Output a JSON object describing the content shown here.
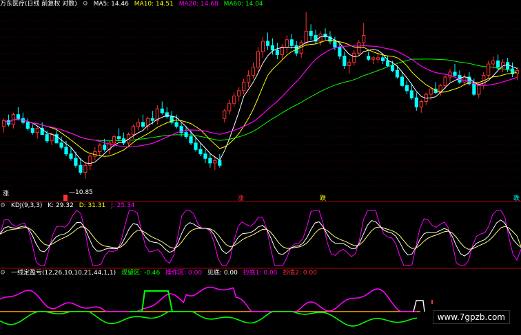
{
  "header": {
    "stock_title": "万东医疗(日线 前复权 对数)",
    "gear_icon": "gear-icon",
    "ma": [
      {
        "label": "MA5: 14.46",
        "color": "#ffffff"
      },
      {
        "label": "MA10: 14.51",
        "color": "#ffff00"
      },
      {
        "label": "MA20: 14.68",
        "color": "#ff00ff"
      },
      {
        "label": "MA60: 14.04",
        "color": "#00ff00"
      }
    ]
  },
  "signals": {
    "left": "涨",
    "middle_zhang": "涨",
    "middle_die": "跌",
    "right": "跌",
    "low_label": "10.85"
  },
  "kdj": {
    "title": "KDJ(9,3,3)",
    "k": "K: 29.32",
    "d": "D: 31.31",
    "j": "J: 25.34"
  },
  "indicator": {
    "title": "一线定盈亏(12,26,10,10,21,44,1,1)",
    "guanwang": "观望区: -0.46",
    "caozuo": "操作区: 0.00",
    "jiandi": "见底: 0.00",
    "chaodi1": "抄底1: 0.00",
    "chaodi2": "抄底2: 0.00"
  },
  "watermark": "www.7gpzb.com",
  "colors": {
    "up": "#ff3232",
    "down": "#00ffff",
    "ma5": "#ffffff",
    "ma10": "#ffff00",
    "ma20": "#ff00ff",
    "ma60": "#00ff00",
    "divider": "#b00000",
    "magenta": "#ff00ff",
    "green": "#00ff00",
    "yellow_kd": "#ffff80",
    "orange": "#ffa500"
  },
  "chart_data": {
    "type": "candlestick",
    "panels": [
      "price",
      "kdj",
      "indicator"
    ],
    "price_low_marker": 10.85,
    "kdj_last": {
      "K": 29.32,
      "D": 31.31,
      "J": 25.34
    },
    "ma_last": {
      "MA5": 14.46,
      "MA10": 14.51,
      "MA20": 14.68,
      "MA60": 14.04
    },
    "indicator_last": {
      "观望区": -0.46,
      "操作区": 0.0,
      "见底": 0.0,
      "抄底1": 0.0,
      "抄底2": 0.0
    },
    "y_range_price": [
      10.5,
      20.5
    ],
    "candles": [
      [
        13.2,
        13.6,
        12.9,
        13.5
      ],
      [
        13.5,
        13.8,
        13.2,
        13.3
      ],
      [
        13.3,
        13.9,
        13.1,
        13.8
      ],
      [
        13.8,
        14.2,
        13.5,
        13.6
      ],
      [
        13.6,
        13.9,
        13.3,
        13.4
      ],
      [
        13.4,
        13.6,
        13.0,
        13.1
      ],
      [
        13.1,
        13.3,
        12.8,
        12.9
      ],
      [
        12.9,
        13.2,
        12.6,
        13.1
      ],
      [
        13.1,
        13.4,
        12.8,
        12.8
      ],
      [
        12.8,
        13.0,
        12.4,
        12.5
      ],
      [
        12.5,
        12.9,
        12.3,
        12.8
      ],
      [
        12.8,
        13.0,
        12.4,
        12.4
      ],
      [
        12.4,
        12.7,
        12.1,
        12.2
      ],
      [
        12.2,
        12.5,
        11.8,
        11.9
      ],
      [
        11.9,
        12.2,
        11.6,
        11.7
      ],
      [
        11.7,
        12.0,
        11.3,
        11.4
      ],
      [
        11.4,
        11.7,
        11.0,
        11.1
      ],
      [
        11.1,
        11.5,
        10.85,
        11.4
      ],
      [
        11.4,
        11.9,
        11.2,
        11.8
      ],
      [
        11.8,
        12.2,
        11.6,
        12.0
      ],
      [
        12.0,
        12.4,
        11.8,
        12.3
      ],
      [
        12.3,
        12.6,
        12.0,
        12.1
      ],
      [
        12.1,
        12.5,
        11.9,
        12.4
      ],
      [
        12.4,
        12.8,
        12.2,
        12.7
      ],
      [
        12.7,
        13.1,
        12.5,
        12.6
      ],
      [
        12.6,
        12.9,
        12.3,
        12.4
      ],
      [
        12.4,
        12.9,
        12.2,
        12.8
      ],
      [
        12.8,
        13.3,
        12.6,
        13.2
      ],
      [
        13.2,
        13.6,
        13.0,
        13.4
      ],
      [
        13.4,
        13.8,
        13.1,
        13.2
      ],
      [
        13.2,
        13.7,
        13.0,
        13.6
      ],
      [
        13.6,
        14.0,
        13.3,
        13.5
      ],
      [
        13.5,
        14.3,
        13.3,
        14.1
      ],
      [
        14.1,
        14.5,
        13.8,
        13.9
      ],
      [
        13.9,
        14.2,
        13.6,
        13.7
      ],
      [
        13.7,
        14.0,
        13.3,
        13.4
      ],
      [
        13.4,
        13.8,
        13.1,
        13.2
      ],
      [
        13.2,
        13.4,
        12.7,
        12.9
      ],
      [
        12.9,
        13.2,
        12.6,
        12.7
      ],
      [
        12.7,
        13.0,
        12.3,
        12.4
      ],
      [
        12.4,
        12.7,
        12.0,
        12.1
      ],
      [
        12.1,
        12.4,
        11.8,
        11.9
      ],
      [
        11.9,
        12.1,
        11.5,
        11.7
      ],
      [
        11.7,
        11.9,
        11.3,
        11.5
      ],
      [
        11.5,
        11.8,
        11.2,
        11.6
      ],
      [
        11.6,
        11.9,
        11.3,
        11.4
      ],
      [
        13.6,
        14.1,
        13.4,
        14.0
      ],
      [
        14.0,
        14.6,
        13.8,
        14.4
      ],
      [
        14.4,
        15.0,
        14.2,
        14.8
      ],
      [
        14.8,
        15.3,
        14.5,
        15.1
      ],
      [
        15.1,
        15.8,
        14.9,
        15.6
      ],
      [
        15.6,
        16.3,
        15.3,
        16.0
      ],
      [
        16.0,
        16.8,
        15.8,
        16.5
      ],
      [
        16.5,
        17.8,
        16.2,
        17.5
      ],
      [
        17.5,
        18.5,
        17.1,
        18.2
      ],
      [
        18.2,
        18.8,
        17.6,
        17.9
      ],
      [
        17.9,
        18.4,
        17.3,
        17.6
      ],
      [
        17.6,
        18.1,
        17.0,
        17.3
      ],
      [
        17.3,
        18.0,
        17.0,
        17.8
      ],
      [
        17.8,
        18.6,
        17.4,
        18.3
      ],
      [
        18.3,
        18.7,
        17.7,
        17.9
      ],
      [
        17.9,
        18.2,
        17.2,
        17.4
      ],
      [
        17.4,
        18.3,
        17.1,
        18.1
      ],
      [
        18.1,
        20.3,
        17.9,
        18.9
      ],
      [
        18.9,
        19.4,
        18.3,
        18.6
      ],
      [
        18.6,
        19.0,
        18.0,
        18.2
      ],
      [
        18.2,
        18.9,
        17.9,
        18.7
      ],
      [
        18.7,
        19.1,
        18.3,
        18.5
      ],
      [
        18.5,
        18.9,
        18.0,
        18.2
      ],
      [
        18.2,
        18.5,
        17.6,
        17.8
      ],
      [
        17.8,
        18.1,
        17.0,
        17.2
      ],
      [
        17.2,
        17.5,
        16.4,
        16.6
      ],
      [
        16.6,
        17.0,
        16.1,
        16.8
      ],
      [
        16.8,
        17.6,
        16.6,
        17.4
      ],
      [
        17.4,
        18.3,
        17.2,
        18.1
      ],
      [
        18.1,
        19.5,
        17.8,
        18.6
      ],
      [
        17.2,
        17.5,
        16.9,
        17.0
      ],
      [
        17.0,
        17.2,
        16.7,
        17.1
      ],
      [
        17.0,
        17.4,
        16.8,
        17.1
      ],
      [
        17.1,
        17.3,
        16.7,
        16.9
      ],
      [
        16.9,
        17.2,
        16.5,
        16.6
      ],
      [
        16.6,
        16.9,
        16.2,
        16.3
      ],
      [
        16.3,
        16.6,
        15.8,
        15.9
      ],
      [
        15.9,
        16.2,
        15.3,
        15.4
      ],
      [
        15.4,
        15.7,
        14.9,
        15.1
      ],
      [
        15.1,
        15.5,
        14.6,
        14.7
      ],
      [
        14.7,
        15.0,
        14.0,
        14.2
      ],
      [
        14.2,
        14.6,
        13.9,
        14.5
      ],
      [
        14.5,
        15.0,
        14.3,
        14.9
      ],
      [
        14.9,
        15.3,
        14.6,
        15.2
      ],
      [
        15.2,
        15.6,
        14.9,
        15.0
      ],
      [
        15.0,
        15.5,
        14.8,
        15.4
      ],
      [
        15.4,
        16.0,
        15.2,
        15.9
      ],
      [
        15.9,
        16.4,
        15.6,
        16.2
      ],
      [
        16.2,
        16.7,
        15.9,
        16.0
      ],
      [
        16.0,
        16.3,
        15.5,
        15.6
      ],
      [
        15.6,
        16.1,
        15.4,
        15.9
      ],
      [
        15.9,
        16.2,
        15.4,
        15.5
      ],
      [
        15.5,
        15.8,
        14.8,
        14.9
      ],
      [
        14.9,
        15.6,
        14.7,
        15.4
      ],
      [
        15.4,
        16.2,
        15.2,
        16.0
      ],
      [
        16.0,
        16.9,
        15.8,
        16.7
      ],
      [
        16.7,
        17.2,
        16.4,
        16.9
      ],
      [
        16.9,
        17.3,
        16.3,
        16.5
      ],
      [
        16.5,
        17.0,
        16.2,
        16.8
      ],
      [
        16.8,
        17.1,
        16.2,
        16.4
      ],
      [
        16.4,
        16.8,
        15.9,
        16.1
      ],
      [
        16.1,
        16.5,
        15.7,
        16.3
      ]
    ]
  }
}
